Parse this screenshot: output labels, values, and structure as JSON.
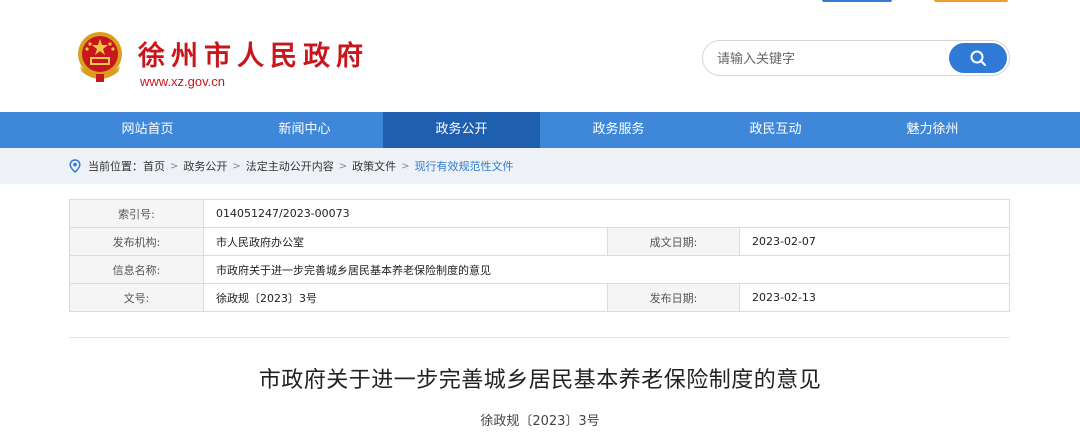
{
  "colors": {
    "brand_red": "#c8161d",
    "nav_blue": "#3f87d8",
    "nav_active": "#1f5fb0",
    "search_blue": "#2f7ad6"
  },
  "header": {
    "title": "徐州市人民政府",
    "url": "www.xz.gov.cn",
    "emblem_icon": "national-emblem-icon"
  },
  "search": {
    "placeholder": "请输入关键字",
    "icon": "search-icon"
  },
  "nav": {
    "items": [
      {
        "label": "网站首页"
      },
      {
        "label": "新闻中心"
      },
      {
        "label": "政务公开",
        "active": true
      },
      {
        "label": "政务服务"
      },
      {
        "label": "政民互动"
      },
      {
        "label": "魅力徐州"
      }
    ]
  },
  "breadcrumb": {
    "icon": "location-pin-icon",
    "prefix": "当前位置：",
    "items": [
      "首页",
      "政务公开",
      "法定主动公开内容",
      "政策文件"
    ],
    "current": "现行有效规范性文件"
  },
  "meta": {
    "index_label": "索引号:",
    "index_value": "014051247/2023-00073",
    "publisher_label": "发布机构:",
    "publisher_value": "市人民政府办公室",
    "created_label": "成文日期:",
    "created_value": "2023-02-07",
    "info_label": "信息名称:",
    "info_value": "市政府关于进一步完善城乡居民基本养老保险制度的意见",
    "docno_label": "文号:",
    "docno_value": "徐政规〔2023〕3号",
    "published_label": "发布日期:",
    "published_value": "2023-02-13"
  },
  "document": {
    "title": "市政府关于进一步完善城乡居民基本养老保险制度的意见",
    "number": "徐政规〔2023〕3号"
  }
}
